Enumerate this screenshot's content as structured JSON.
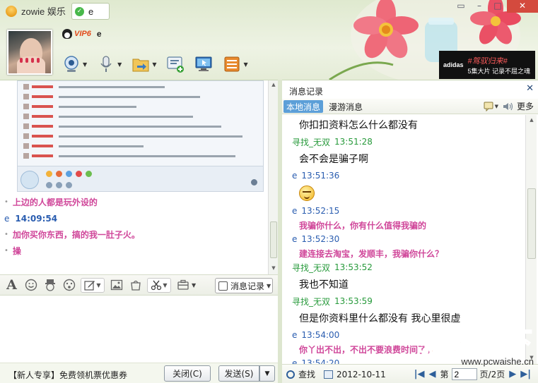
{
  "window": {
    "app_title": "zowie 娱乐",
    "tab_label": "e",
    "vip_badge": "VIP6",
    "contact_name": "e"
  },
  "ad": {
    "logo": "adidas",
    "line1": "#驾驭归来#",
    "line2": "5集大片 记录不屈之魂"
  },
  "chat": {
    "lines": [
      {
        "type": "pink",
        "text": "上边的人都是玩外设的"
      },
      {
        "type": "time",
        "sender": "e",
        "time": "14:09:54"
      },
      {
        "type": "pink",
        "text": "加你买你东西，搞的我一肚子火。"
      },
      {
        "type": "pink",
        "text": "操"
      }
    ]
  },
  "input_toolbar": {
    "history_label": "消息记录"
  },
  "bottom": {
    "promo": "【新人专享】免费领机票优惠券",
    "close_label": "关闭(C)",
    "send_label": "发送(S)"
  },
  "history": {
    "title": "消息记录",
    "tab_local": "本地消息",
    "tab_roam": "漫游消息",
    "more": "更多",
    "entries": [
      {
        "kind": "msg",
        "style": "normal",
        "text": "你扣扣资料怎么什么都没有"
      },
      {
        "kind": "sender",
        "color": "green",
        "name": "寻找_无双",
        "time": "13:51:28"
      },
      {
        "kind": "msg",
        "style": "normal",
        "text": "会不会是骗子啊"
      },
      {
        "kind": "sender",
        "color": "blue",
        "name": "e",
        "time": "13:51:36"
      },
      {
        "kind": "emoji",
        "icon": "smiley-emoji-icon"
      },
      {
        "kind": "sender",
        "color": "blue",
        "name": "e",
        "time": "13:52:15"
      },
      {
        "kind": "msg",
        "style": "pink",
        "text": "我骗你什么，你有什么值得我骗的"
      },
      {
        "kind": "sender",
        "color": "blue",
        "name": "e",
        "time": "13:52:30"
      },
      {
        "kind": "msg",
        "style": "pink",
        "text": "建连接去淘宝，发顺丰，我骗你什么？"
      },
      {
        "kind": "sender",
        "color": "green",
        "name": "寻找_无双",
        "time": "13:53:52"
      },
      {
        "kind": "msg",
        "style": "normal",
        "text": "我也不知道"
      },
      {
        "kind": "sender",
        "color": "green",
        "name": "寻找_无双",
        "time": "13:53:59"
      },
      {
        "kind": "msg",
        "style": "normal",
        "text": "但是你资料里什么都没有 我心里很虚"
      },
      {
        "kind": "sender",
        "color": "blue",
        "name": "e",
        "time": "13:54:00"
      },
      {
        "kind": "msg",
        "style": "pink",
        "text": "你丫出不出，不出不要浪费时间了。"
      },
      {
        "kind": "sender",
        "color": "blue",
        "name": "e",
        "time": "13:54:20"
      }
    ],
    "search_label": "查找",
    "date": "2012-10-11",
    "page_prefix": "第",
    "page_value": "2",
    "page_suffix": "页/2页"
  },
  "watermark": {
    "big": "批设天下",
    "url": "www.pcwaishe.cn"
  },
  "colors": {
    "accent_blue": "#5c9fd8",
    "pink_msg": "#d0479a",
    "green_sender": "#279a3b",
    "blue_sender": "#2a5db0"
  }
}
